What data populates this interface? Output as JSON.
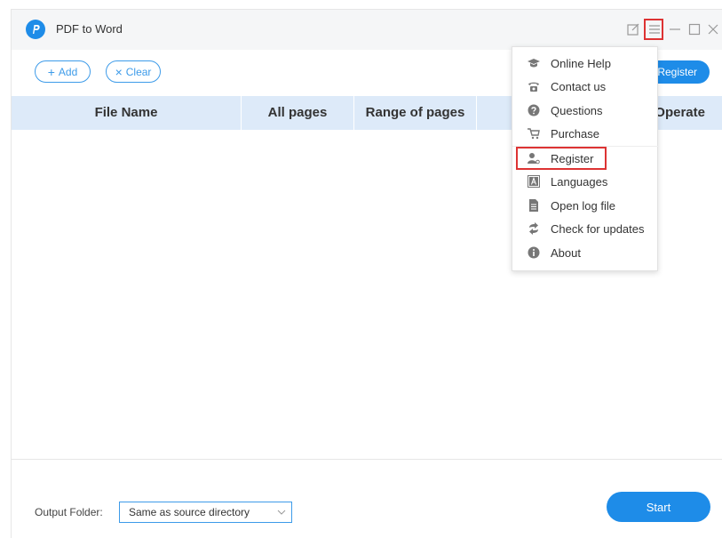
{
  "app": {
    "title": "PDF to Word"
  },
  "toolbar": {
    "add_label": "Add",
    "add_symbol": "+",
    "clear_label": "Clear",
    "clear_symbol": "×",
    "register_label": "Register"
  },
  "table": {
    "columns": [
      "File Name",
      "All pages",
      "Range of pages",
      "Operate"
    ],
    "rows": []
  },
  "menu": {
    "items": [
      {
        "label": "Online Help",
        "icon": "graduation-cap-icon"
      },
      {
        "label": "Contact us",
        "icon": "phone-icon"
      },
      {
        "label": "Questions",
        "icon": "question-icon"
      },
      {
        "label": "Purchase",
        "icon": "cart-icon"
      },
      {
        "label": "Register",
        "icon": "user-key-icon"
      },
      {
        "label": "Languages",
        "icon": "language-icon"
      },
      {
        "label": "Open log file",
        "icon": "file-icon"
      },
      {
        "label": "Check for updates",
        "icon": "refresh-icon"
      },
      {
        "label": "About",
        "icon": "info-icon"
      }
    ]
  },
  "footer": {
    "output_folder_label": "Output Folder:",
    "output_folder_value": "Same as source directory",
    "start_label": "Start"
  },
  "colors": {
    "accent": "#1e8ce8",
    "header_bg": "#ddeaf9",
    "highlight": "#dd3333"
  }
}
